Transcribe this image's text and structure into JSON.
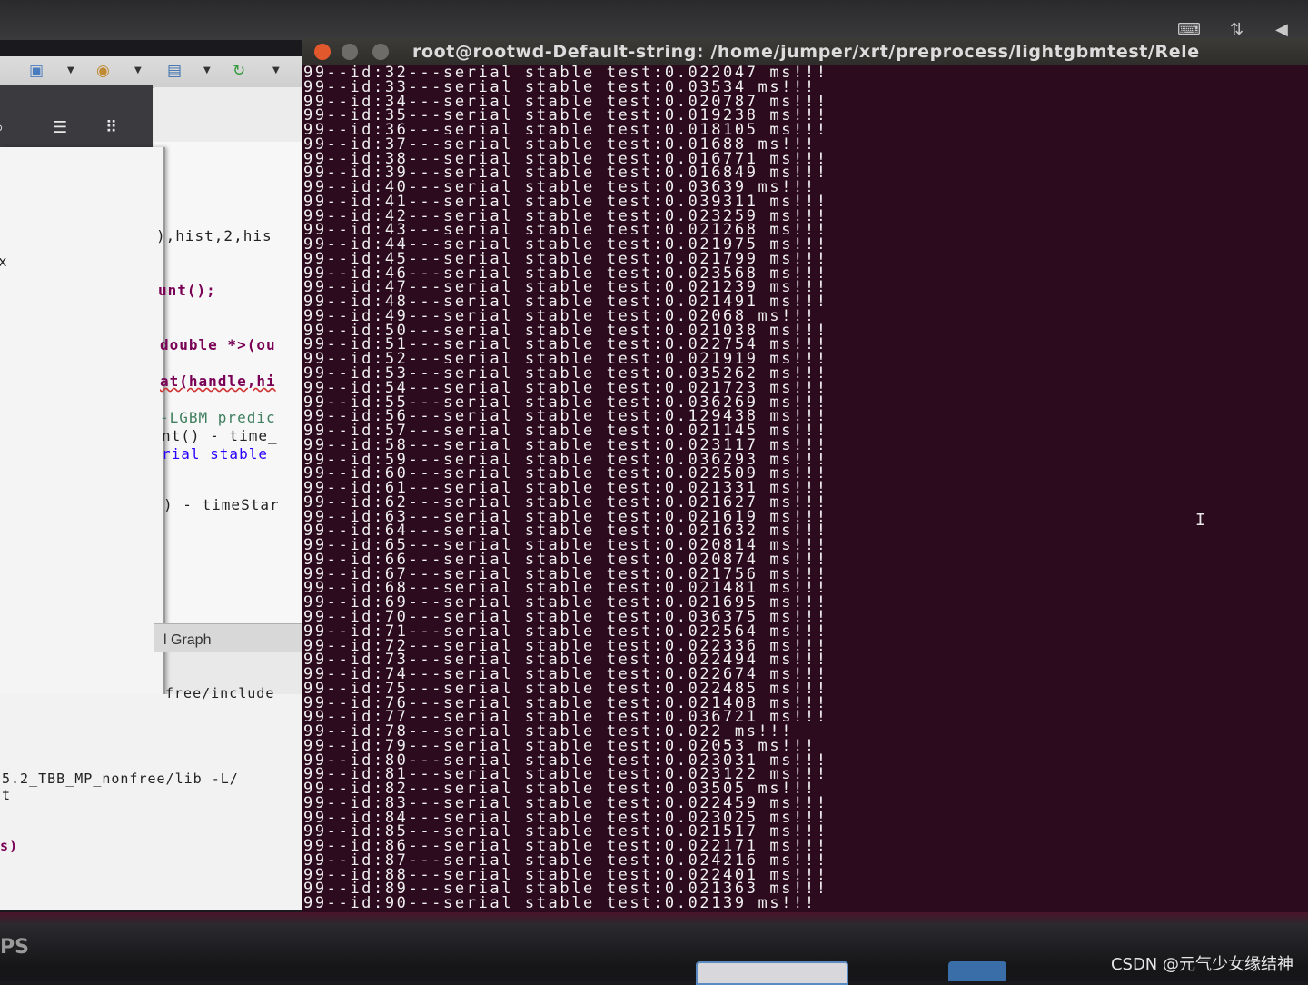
{
  "terminal": {
    "title": "root@rootwd-Default-string: /home/jumper/xrt/preprocess/lightgbmtest/Rele",
    "lines": [
      "99--id:32---serial stable test:0.022047 ms!!!",
      "99--id:33---serial stable test:0.03534 ms!!!",
      "99--id:34---serial stable test:0.020787 ms!!!",
      "99--id:35---serial stable test:0.019238 ms!!!",
      "99--id:36---serial stable test:0.018105 ms!!!",
      "99--id:37---serial stable test:0.01688 ms!!!",
      "99--id:38---serial stable test:0.016771 ms!!!",
      "99--id:39---serial stable test:0.016849 ms!!!",
      "99--id:40---serial stable test:0.03639 ms!!!",
      "99--id:41---serial stable test:0.039311 ms!!!",
      "99--id:42---serial stable test:0.023259 ms!!!",
      "99--id:43---serial stable test:0.021268 ms!!!",
      "99--id:44---serial stable test:0.021975 ms!!!",
      "99--id:45---serial stable test:0.021799 ms!!!",
      "99--id:46---serial stable test:0.023568 ms!!!",
      "99--id:47---serial stable test:0.021239 ms!!!",
      "99--id:48---serial stable test:0.021491 ms!!!",
      "99--id:49---serial stable test:0.02068 ms!!!",
      "99--id:50---serial stable test:0.021038 ms!!!",
      "99--id:51---serial stable test:0.022754 ms!!!",
      "99--id:52---serial stable test:0.021919 ms!!!",
      "99--id:53---serial stable test:0.035262 ms!!!",
      "99--id:54---serial stable test:0.021723 ms!!!",
      "99--id:55---serial stable test:0.036269 ms!!!",
      "99--id:56---serial stable test:0.129438 ms!!!",
      "99--id:57---serial stable test:0.021145 ms!!!",
      "99--id:58---serial stable test:0.023117 ms!!!",
      "99--id:59---serial stable test:0.036293 ms!!!",
      "99--id:60---serial stable test:0.022509 ms!!!",
      "99--id:61---serial stable test:0.021331 ms!!!",
      "99--id:62---serial stable test:0.021627 ms!!!",
      "99--id:63---serial stable test:0.021619 ms!!!",
      "99--id:64---serial stable test:0.021632 ms!!!",
      "99--id:65---serial stable test:0.020814 ms!!!",
      "99--id:66---serial stable test:0.020874 ms!!!",
      "99--id:67---serial stable test:0.021756 ms!!!",
      "99--id:68---serial stable test:0.021481 ms!!!",
      "99--id:69---serial stable test:0.021695 ms!!!",
      "99--id:70---serial stable test:0.036375 ms!!!",
      "99--id:71---serial stable test:0.022564 ms!!!",
      "99--id:72---serial stable test:0.022336 ms!!!",
      "99--id:73---serial stable test:0.022494 ms!!!",
      "99--id:74---serial stable test:0.022674 ms!!!",
      "99--id:75---serial stable test:0.022485 ms!!!",
      "99--id:76---serial stable test:0.021408 ms!!!",
      "99--id:77---serial stable test:0.036721 ms!!!",
      "99--id:78---serial stable test:0.022 ms!!!",
      "99--id:79---serial stable test:0.02053 ms!!!",
      "99--id:80---serial stable test:0.023031 ms!!!",
      "99--id:81---serial stable test:0.023122 ms!!!",
      "99--id:82---serial stable test:0.03505 ms!!!",
      "99--id:83---serial stable test:0.022459 ms!!!",
      "99--id:84---serial stable test:0.023025 ms!!!",
      "99--id:85---serial stable test:0.021517 ms!!!",
      "99--id:86---serial stable test:0.022171 ms!!!",
      "99--id:87---serial stable test:0.024216 ms!!!",
      "99--id:88---serial stable test:0.022401 ms!!!",
      "99--id:89---serial stable test:0.021363 ms!!!",
      "99--id:90---serial stable test:0.02139 ms!!!"
    ]
  },
  "ide": {
    "code_lines": [
      {
        "text": "),hist,2,his",
        "style": "plain"
      },
      {
        "text": "unt();",
        "style": "kw"
      },
      {
        "text": "double *>(ou",
        "style": "kw"
      },
      {
        "text": "at(handle,hi",
        "style": "kw"
      },
      {
        "text": "-LGBM predic",
        "style": "cm"
      },
      {
        "text": "nt() - time_",
        "style": "plain"
      },
      {
        "text": "rial stable",
        "style": "str"
      },
      {
        "text": ") - timeStar",
        "style": "plain"
      }
    ],
    "sidebar_char": "x",
    "graph_tab": "l Graph",
    "console_lines": [
      "free/include",
      "5.2_TBB_MP_nonfree/lib -L/",
      "t",
      "s)"
    ]
  },
  "bottom": {
    "brand": "PS",
    "watermark": "CSDN @元气少女缘结神"
  },
  "colors": {
    "terminal_bg": "#2c0b1e",
    "terminal_text": "#f0f0f0",
    "close_button": "#e2582d",
    "window_button": "#6e6c68"
  },
  "icons": {
    "keyboard": "keyboard-icon",
    "network": "network-icon",
    "volume": "volume-icon",
    "search": "search-icon",
    "list": "list-icon",
    "grid": "grid-icon"
  }
}
